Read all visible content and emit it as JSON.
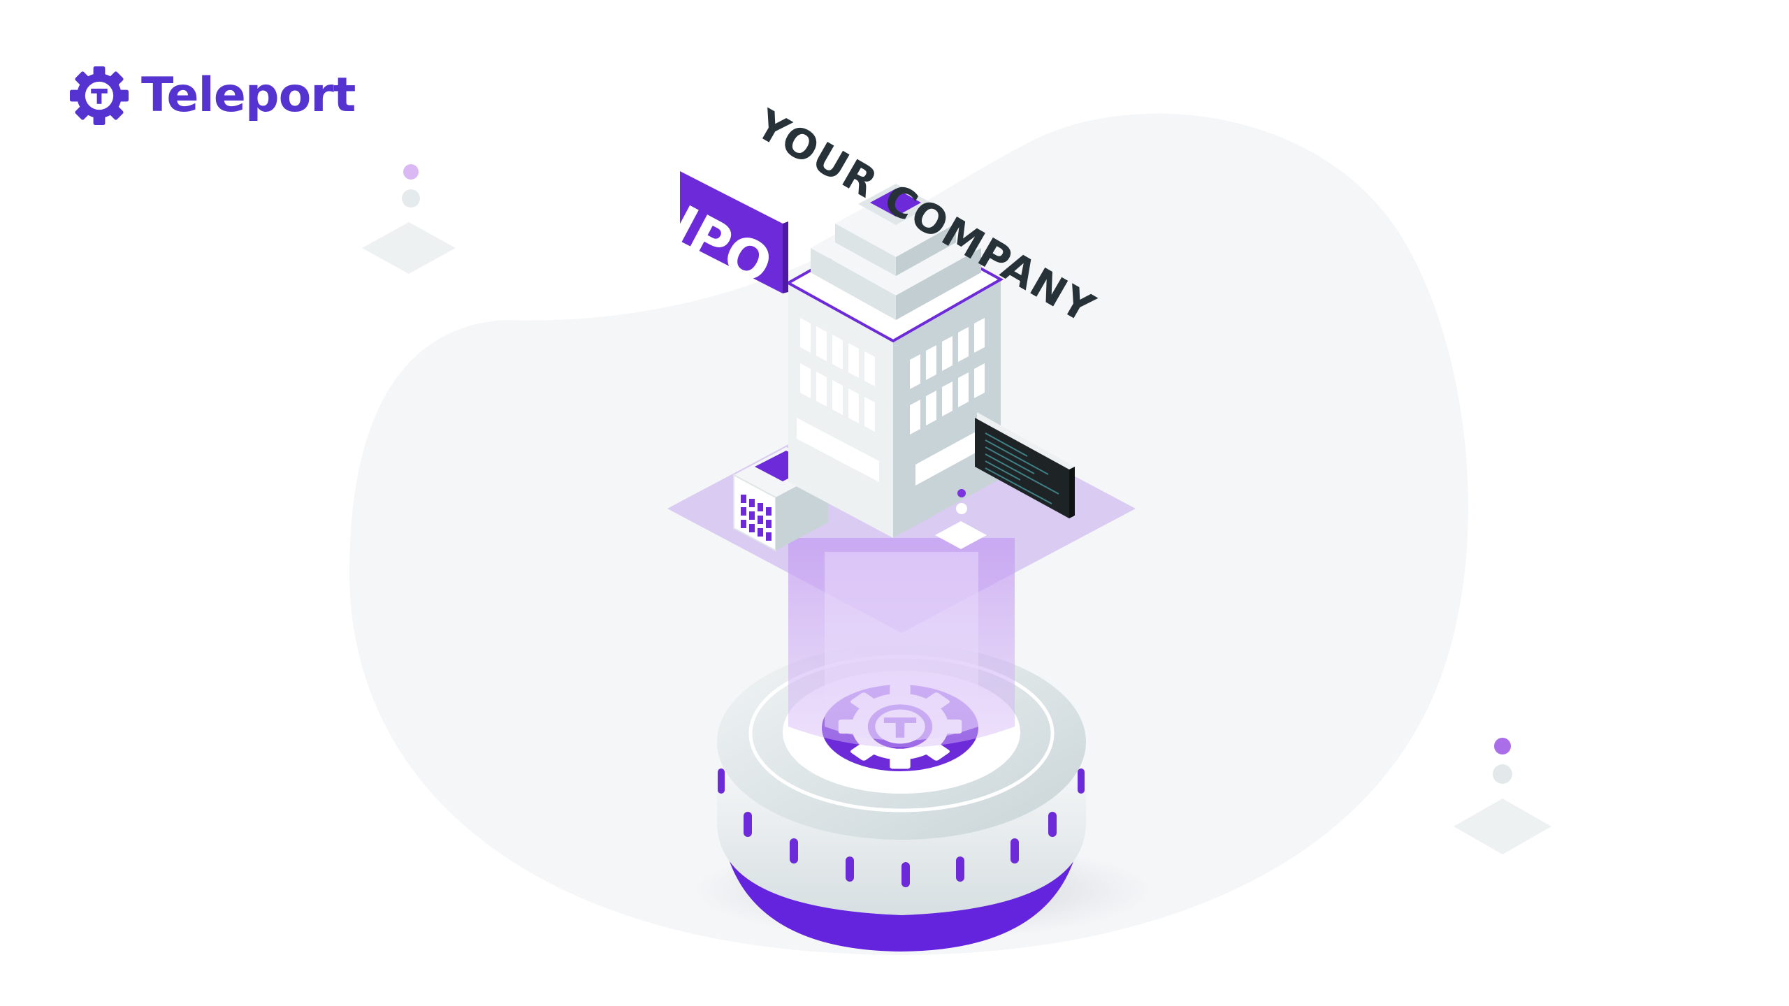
{
  "brand": {
    "name": "Teleport",
    "logo_icon": "teleport-gear-icon",
    "color": "#5533d1"
  },
  "scene": {
    "headline": "YOUR COMPANY",
    "badge": "IPO",
    "colors": {
      "primary": "#6d2ad8",
      "light_purple": "#c9a6f2",
      "blob": "#f5f6f8",
      "text_dark": "#263238"
    }
  }
}
